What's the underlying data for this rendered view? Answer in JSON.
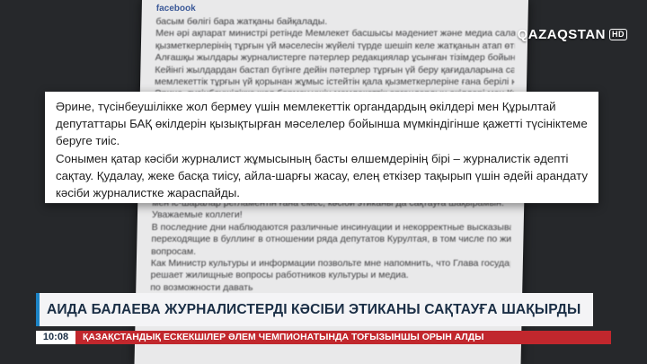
{
  "background_doc": {
    "brand": "facebook",
    "upper_lines": [
      "басым бөлігі бара жатқаны байқалады.",
      "Мен әрі ақпарат министрі ретінде Мемлекет басшысы мәдениет және медиа саласы",
      "қызметкерлерінің тұрғын үй мәселесін жүйелі түрде шешіп келе жатқанын атап өткім келеді.",
      "Алғашқы жылдары журналистерге пәтерлер редакциялар ұсынған тізімдер бойынша берілді.",
      "Кейінгі жылдардан бастап бүгінге дейін пәтерлер тұрғын үй беру қағидаларына сәйкес,",
      "мемлекеттік тұрғын үй қорынан жұмыс істейтін қала қызметкерлеріне ғана берілі келеді.",
      "Әрине, түсінбеушілікке жол бермеу үшін мемлекеттік органдардың өкілдері мен Құрылтай"
    ],
    "lower_lines": [
      "мен іс-шаралар регламентін ғана емес, кәсіби этиканы да сақтауға шақырамын.",
      "Уважаемые коллеги!",
      "В последние дни наблюдаются различные инсинуации и некорректные высказывания,",
      "переходящие в буллинг в отношении ряда депутатов Курултая, в том числе по жилищным",
      "вопросам.",
      "Как Министр культуры и информации позвольте мне напомнить, что Глава государства на",
      "решает жилищные вопросы работников культуры и медиа.",
      "по возможности давать"
    ]
  },
  "channel": {
    "name": "QAZAQSTAN",
    "badge": "HD"
  },
  "quote": {
    "paragraph1": "Әрине, түсінбеушілікке жол бермеу үшін мемлекеттік органдардың өкілдері мен Құрылтай депутаттары БАҚ өкілдерін қызықтырған мәселелер бойынша мүмкіндігінше қажетті түсініктеме беруге тиіс.",
    "paragraph2": "Сонымен қатар кәсіби журналист жұмысының басты өлшемдерінің бірі – журналистік әдепті сақтау. Қудалау, жеке басқа тиісу, айла-шарғы жасау, елең еткізер тақырып үшін әдейі арандату кәсіби журналистке жараспайды."
  },
  "lower_third": {
    "headline": "АИДА БАЛАЕВА ЖУРНАЛИСТЕРДІ КӘСІБИ ЭТИКАНЫ САҚТАУҒА ШАҚЫРДЫ",
    "time": "10:08",
    "ticker": "ҚАЗАҚСТАНДЫҚ ЕСКЕКШІЛЕР ӘЛЕМ ЧЕМПИОНАТЫНДА ТОҒЫЗЫНШЫ ОРЫН АЛДЫ"
  }
}
